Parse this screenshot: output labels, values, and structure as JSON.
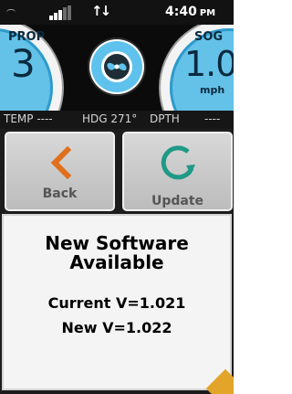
{
  "status_bar": {
    "gps_icon": "gps-arc-icon",
    "signal_bars": 5,
    "signal_active_bars": 3,
    "data_icon": "data-transfer-arrows-icon",
    "data_arrows": "↑↓",
    "time": "4:40",
    "ampm": "PM"
  },
  "gauges": {
    "prop": {
      "label": "PROP",
      "value": "3"
    },
    "sog": {
      "label": "SOG",
      "value": "1.0",
      "unit": "mph"
    },
    "center_icon": "propeller-icon",
    "colors": {
      "gauge_fill": "#64c1e8",
      "gauge_text": "#0b2a3e"
    }
  },
  "info_strip": {
    "temp": "TEMP ----",
    "hdg": "HDG 271°",
    "dpth": "DPTH",
    "dpth_value": "----"
  },
  "buttons": {
    "back": {
      "label": "Back",
      "icon": "chevron-left-icon",
      "icon_color": "#e0701c"
    },
    "update": {
      "label": "Update",
      "icon": "refresh-arrow-icon",
      "icon_color": "#1f9a86"
    }
  },
  "message": {
    "title_line1": "New Software",
    "title_line2": "Available",
    "current": "Current V=1.021",
    "new": "New V=1.022"
  }
}
